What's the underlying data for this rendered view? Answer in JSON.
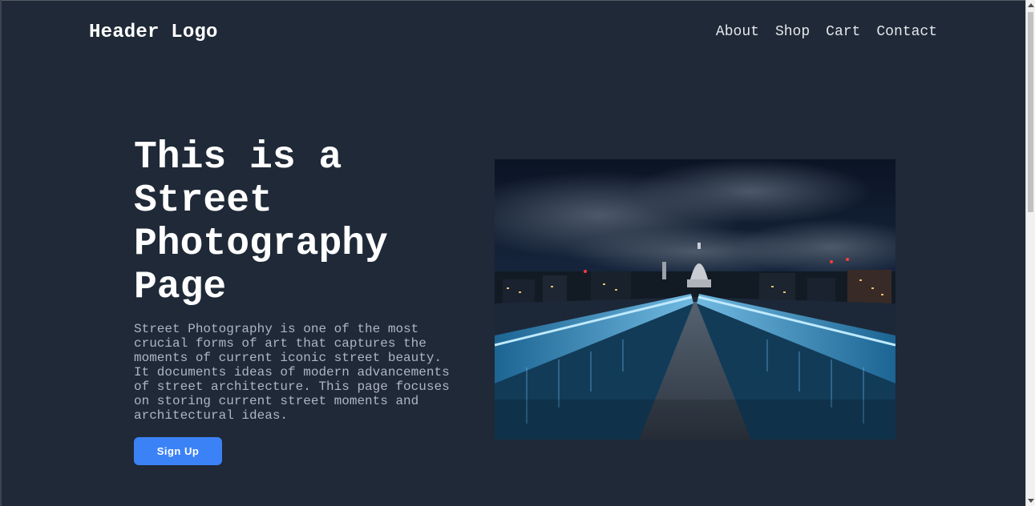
{
  "header": {
    "logo": "Header Logo",
    "nav": [
      "About",
      "Shop",
      "Cart",
      "Contact"
    ]
  },
  "hero": {
    "title": "This is a Street Photography Page",
    "description": "Street Photography is one of the most crucial forms of art that captures the moments of current iconic street beauty. It documents ideas of modern advancements of street architecture. This page focuses on storing current street moments and architectural ideas.",
    "cta_label": "Sign Up"
  },
  "colors": {
    "background": "#1f2937",
    "accent": "#3b82f6"
  },
  "icons": {
    "scroll_up": "scroll-up-arrow-icon",
    "scroll_down": "scroll-down-arrow-icon"
  }
}
